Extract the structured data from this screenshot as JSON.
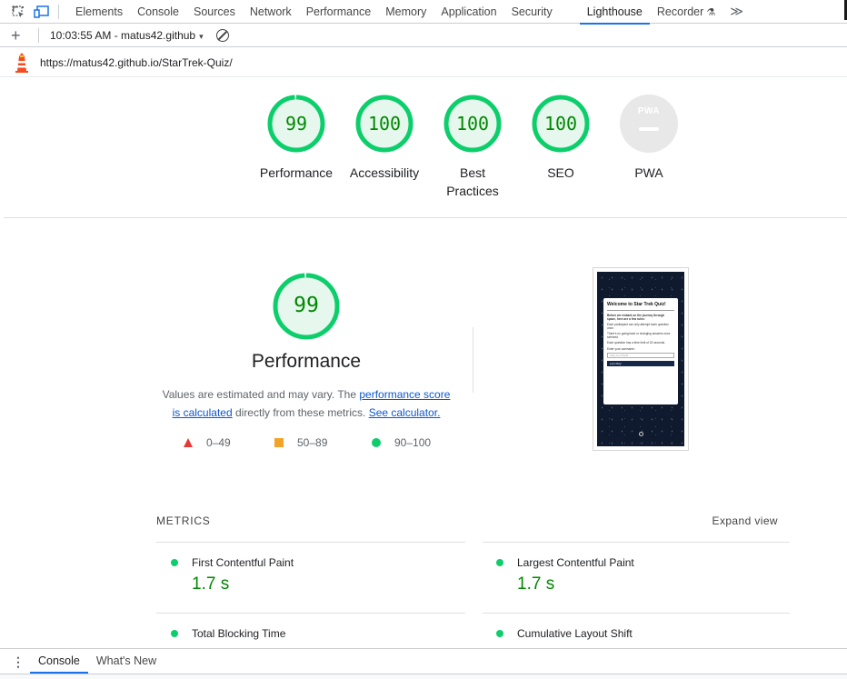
{
  "devtools": {
    "tabs": [
      {
        "label": "Elements"
      },
      {
        "label": "Console"
      },
      {
        "label": "Sources"
      },
      {
        "label": "Network"
      },
      {
        "label": "Performance"
      },
      {
        "label": "Memory"
      },
      {
        "label": "Application"
      },
      {
        "label": "Security"
      },
      {
        "label": "Lighthouse"
      },
      {
        "label": "Recorder"
      }
    ],
    "active_tab": "Lighthouse",
    "more_label": "≫"
  },
  "toolbar": {
    "add_label": "+",
    "report_selector": "10:03:55 AM - matus42.github",
    "caret": "▾"
  },
  "report": {
    "url": "https://matus42.github.io/StarTrek-Quiz/",
    "categories": [
      {
        "label": "Performance",
        "score": "99",
        "score_value": 99
      },
      {
        "label": "Accessibility",
        "score": "100",
        "score_value": 100
      },
      {
        "label": "Best Practices",
        "label_line1": "Best",
        "label_line2": "Practices",
        "score": "100",
        "score_value": 100
      },
      {
        "label": "SEO",
        "score": "100",
        "score_value": 100
      },
      {
        "label": "PWA",
        "badge": "PWA"
      }
    ],
    "performance": {
      "score": "99",
      "score_value": 99,
      "title": "Performance",
      "desc_pre": "Values are estimated and may vary. The ",
      "desc_link1_a": "performance score",
      "desc_link1_b": "is calculated",
      "desc_mid": " directly from these metrics. ",
      "desc_link2": "See calculator.",
      "legend": [
        {
          "label": "0–49",
          "color": "#e53935"
        },
        {
          "label": "50–89",
          "color": "#f3a328"
        },
        {
          "label": "90–100",
          "color": "#0cce6b"
        }
      ]
    },
    "screenshot": {
      "title": "Welcome to Star Trek Quiz!",
      "intro": "Before we embark on the journey through space, here are a few rules:",
      "rules": [
        "Each participant can only attempt each question once.",
        "There's no going back or changing answers once selected.",
        "Each question has a time limit of 15 seconds."
      ],
      "input_label": "Enter your username:",
      "input_placeholder": "Jean-Luc Picard",
      "button": "Let's Play!"
    },
    "metrics": {
      "title": "METRICS",
      "expand": "Expand view",
      "items": [
        {
          "label": "First Contentful Paint",
          "value": "1.7 s"
        },
        {
          "label": "Largest Contentful Paint",
          "value": "1.7 s"
        },
        {
          "label": "Total Blocking Time",
          "value": ""
        },
        {
          "label": "Cumulative Layout Shift",
          "value": ""
        }
      ]
    }
  },
  "drawer": {
    "tabs": [
      {
        "label": "Console"
      },
      {
        "label": "What's New"
      }
    ],
    "active_tab": "Console"
  },
  "colors": {
    "pass": "#0cce6b",
    "pass_text": "#008800",
    "average": "#f3a328",
    "fail": "#e53935",
    "accent": "#1a73e8"
  }
}
